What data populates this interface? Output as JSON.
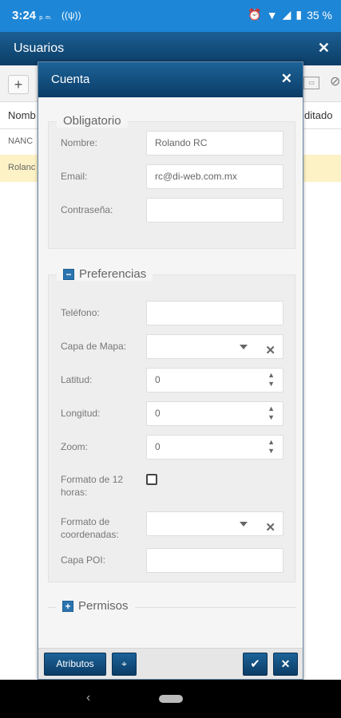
{
  "status_bar": {
    "time": "3:24",
    "time_suffix": "p. m.",
    "battery": "35 %"
  },
  "background": {
    "title": "Usuarios",
    "toolbar": {
      "add_label": "+"
    },
    "columns": {
      "name": "Nomb",
      "right": "ditado"
    },
    "rows": [
      "NANC",
      "Rolanc"
    ]
  },
  "modal": {
    "title": "Cuenta",
    "sections": {
      "mandatory": "Obligatorio",
      "preferences": "Preferencias",
      "permissions": "Permisos"
    },
    "fields": {
      "name": {
        "label": "Nombre:",
        "value": "Rolando RC"
      },
      "email": {
        "label": "Email:",
        "value": "rc@di-web.com.mx"
      },
      "password": {
        "label": "Contraseña:",
        "value": ""
      },
      "phone": {
        "label": "Teléfono:",
        "value": ""
      },
      "map_layer": {
        "label": "Capa de Mapa:",
        "value": ""
      },
      "latitude": {
        "label": "Latitud:",
        "value": "0"
      },
      "longitude": {
        "label": "Longitud:",
        "value": "0"
      },
      "zoom": {
        "label": "Zoom:",
        "value": "0"
      },
      "twelve_hour": {
        "label_line1": "Formato de 12",
        "label_line2": "horas:",
        "checked": false
      },
      "coord_format": {
        "label_line1": "Formato de",
        "label_line2": "coordenadas:",
        "value": ""
      },
      "poi_layer": {
        "label": "Capa POI:",
        "value": ""
      }
    },
    "footer": {
      "attributes_button": "Atributos"
    }
  },
  "colors": {
    "accent": "#1e86d6",
    "header": "#0c3d66",
    "selected_row": "#fdf2c6"
  },
  "icons": [
    "antenna-icon",
    "alarm-icon",
    "wifi-icon",
    "signal-icon",
    "battery-icon",
    "close-icon",
    "minus-toggle-icon",
    "plus-toggle-icon",
    "map-pin-icon",
    "checkmark-icon",
    "back-icon",
    "home-pill-icon"
  ]
}
